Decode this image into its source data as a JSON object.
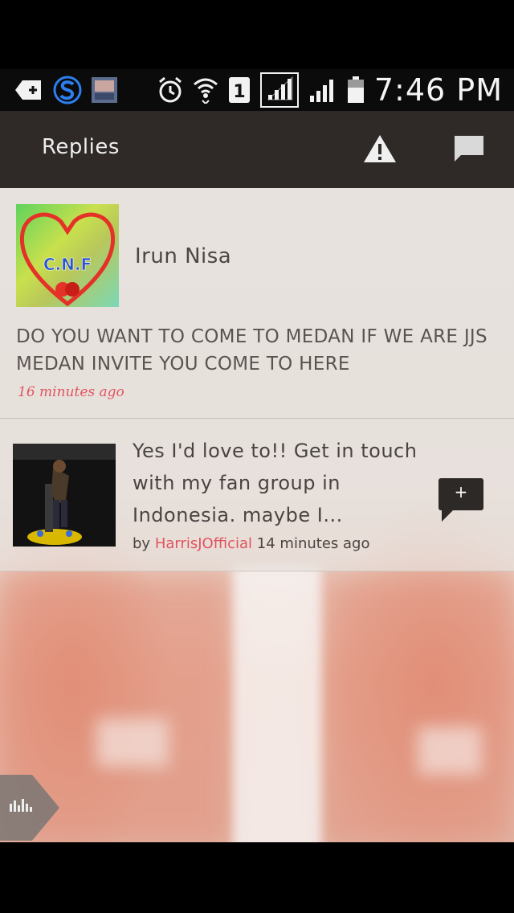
{
  "statusbar": {
    "time": "7:46 PM",
    "sim_label": "1",
    "icons": [
      "message-plus-icon",
      "s-app-icon",
      "thumbnail-app-icon",
      "alarm-icon",
      "wifi-icon",
      "sim1-icon",
      "signal-strength-icon",
      "signal-strength-2-icon",
      "battery-icon"
    ]
  },
  "actionbar": {
    "title": "Replies",
    "icons": [
      "warning-icon",
      "chat-icon"
    ]
  },
  "replies": [
    {
      "author": "Irun Nisa",
      "avatar_text": "C.N.F",
      "message": "DO YOU WANT TO COME TO MEDAN IF WE ARE JJS MEDAN INVITE YOU COME TO HERE",
      "time": "16 minutes ago"
    },
    {
      "message": "Yes I'd love to!! Get in touch with my fan group in Indonesia. maybe I...",
      "by_label": "by",
      "user": "HarrisJOfficial",
      "time": "14 minutes ago",
      "reply_button_label": "+"
    }
  ],
  "colors": {
    "actionbar": "#2f2a27",
    "accent": "#e0545f"
  }
}
